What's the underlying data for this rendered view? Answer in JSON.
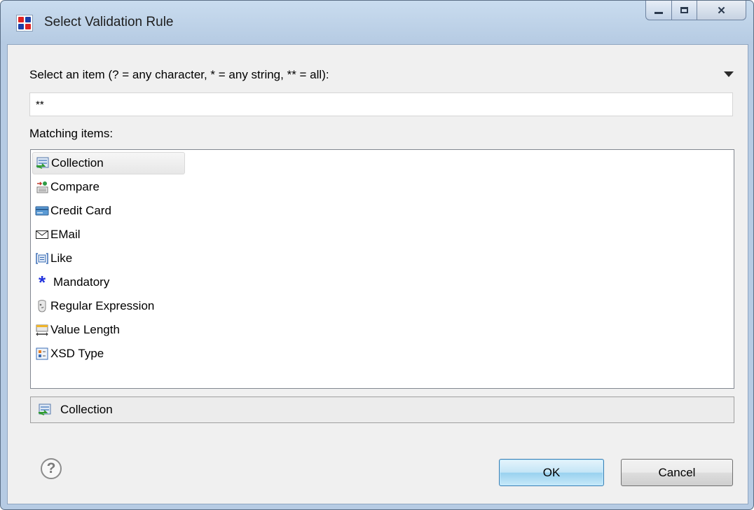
{
  "window": {
    "title": "Select Validation Rule",
    "caption_buttons": {
      "minimize": "—",
      "maximize": "□",
      "close": "✕"
    }
  },
  "prompt": "Select an item (? = any character, * = any string, ** = all):",
  "filter": {
    "value": "**"
  },
  "matching_label": "Matching items:",
  "items": [
    {
      "label": "Collection",
      "icon": "collection-icon",
      "selected": true
    },
    {
      "label": "Compare",
      "icon": "compare-icon"
    },
    {
      "label": "Credit Card",
      "icon": "credit-card-icon"
    },
    {
      "label": "EMail",
      "icon": "email-icon"
    },
    {
      "label": "Like",
      "icon": "like-icon"
    },
    {
      "label": "Mandatory",
      "icon": "mandatory-asterisk-icon"
    },
    {
      "label": "Regular Expression",
      "icon": "regex-icon"
    },
    {
      "label": "Value Length",
      "icon": "value-length-icon"
    },
    {
      "label": "XSD Type",
      "icon": "xsd-type-icon"
    }
  ],
  "detail": {
    "label": "Collection",
    "icon": "collection-icon"
  },
  "buttons": {
    "help": "?",
    "ok": "OK",
    "cancel": "Cancel"
  },
  "colors": {
    "title_bar": "#b9cee6",
    "ok_border": "#3c7fb1",
    "mandatory_blue": "#2233dd"
  }
}
